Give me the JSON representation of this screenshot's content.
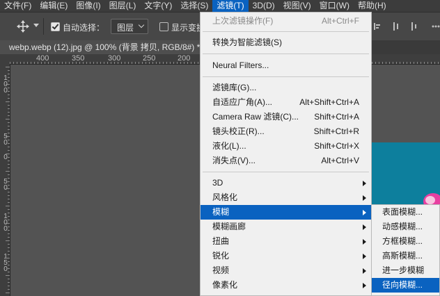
{
  "menubar": {
    "items": [
      {
        "label": "文件(F)"
      },
      {
        "label": "编辑(E)"
      },
      {
        "label": "图像(I)"
      },
      {
        "label": "图层(L)"
      },
      {
        "label": "文字(Y)"
      },
      {
        "label": "选择(S)"
      },
      {
        "label": "滤镜(T)",
        "active": true
      },
      {
        "label": "3D(D)"
      },
      {
        "label": "视图(V)"
      },
      {
        "label": "窗口(W)"
      },
      {
        "label": "帮助(H)"
      }
    ]
  },
  "options": {
    "auto_select_label": "自动选择：",
    "auto_select_checked": true,
    "layer_select_value": "图层",
    "show_transform_label": "显示变换控件",
    "show_transform_checked": false
  },
  "document": {
    "tab_title": "webp.webp (12).jpg @ 100% (背景 拷贝, RGB/8#) *"
  },
  "ruler": {
    "h_labels": [
      "400",
      "350",
      "300",
      "250",
      "200"
    ],
    "v_labels": [
      "1 0 0",
      "5 0",
      "0",
      "5 0",
      "1 0 0",
      "1 5 0"
    ]
  },
  "filter_menu": {
    "items": [
      {
        "label": "上次滤镜操作(F)",
        "shortcut": "Alt+Ctrl+F",
        "disabled": true
      },
      {
        "label": "转换为智能滤镜(S)"
      },
      {
        "label": "Neural Filters..."
      },
      {
        "label": "滤镜库(G)..."
      },
      {
        "label": "自适应广角(A)...",
        "shortcut": "Alt+Shift+Ctrl+A"
      },
      {
        "label": "Camera Raw 滤镜(C)...",
        "shortcut": "Shift+Ctrl+A"
      },
      {
        "label": "镜头校正(R)...",
        "shortcut": "Shift+Ctrl+R"
      },
      {
        "label": "液化(L)...",
        "shortcut": "Shift+Ctrl+X"
      },
      {
        "label": "消失点(V)...",
        "shortcut": "Alt+Ctrl+V"
      },
      {
        "label": "3D",
        "submenu": true
      },
      {
        "label": "风格化",
        "submenu": true
      },
      {
        "label": "模糊",
        "submenu": true,
        "highlighted": true
      },
      {
        "label": "模糊画廊",
        "submenu": true
      },
      {
        "label": "扭曲",
        "submenu": true
      },
      {
        "label": "锐化",
        "submenu": true
      },
      {
        "label": "视频",
        "submenu": true
      },
      {
        "label": "像素化",
        "submenu": true
      }
    ]
  },
  "blur_submenu": {
    "items": [
      {
        "label": "表面模糊..."
      },
      {
        "label": "动感模糊..."
      },
      {
        "label": "方框模糊..."
      },
      {
        "label": "高斯模糊..."
      },
      {
        "label": "进一步模糊"
      },
      {
        "label": "径向模糊...",
        "highlighted": true
      }
    ]
  },
  "colors": {
    "highlight": "#0a62c0",
    "canvas_image": "#0d7f9d"
  }
}
